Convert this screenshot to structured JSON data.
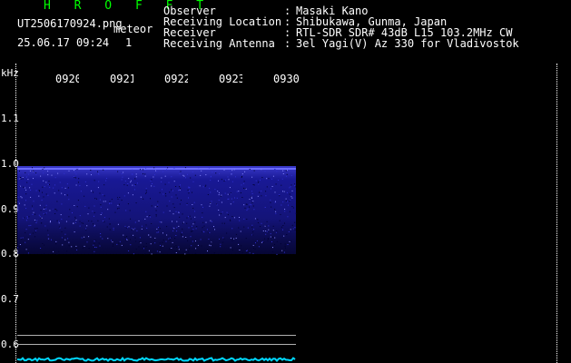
{
  "header": {
    "brand": "H R O F F T",
    "filename": "UT2506170924.png",
    "category": "meteor",
    "datetime": "25.06.17 09:24",
    "count": "1"
  },
  "observation": [
    {
      "label": "Observer",
      "value": "Masaki Kano"
    },
    {
      "label": "Receiving Location",
      "value": "Shibukawa, Gunma, Japan"
    },
    {
      "label": "Receiver",
      "value": "RTL-SDR SDR# 43dB L15 103.2MHz CW"
    },
    {
      "label": "Receiving Antenna",
      "value": "3el Yagi(V) Az 330 for Vladivostok"
    }
  ],
  "axis": {
    "y_unit": "kHz",
    "y_ticks": [
      "1.1",
      "1.0",
      "0.9",
      "0.8",
      "0.7",
      "0.6"
    ],
    "x_ticks": [
      "0920",
      "0921",
      "0922",
      "0923",
      "0930"
    ]
  },
  "colors": {
    "header_brand": "#00ff00",
    "signal_band": "#2a2ad0",
    "signal_edge": "#6060ff",
    "baseline": "#00d8ff",
    "grid": "#ffffff"
  }
}
